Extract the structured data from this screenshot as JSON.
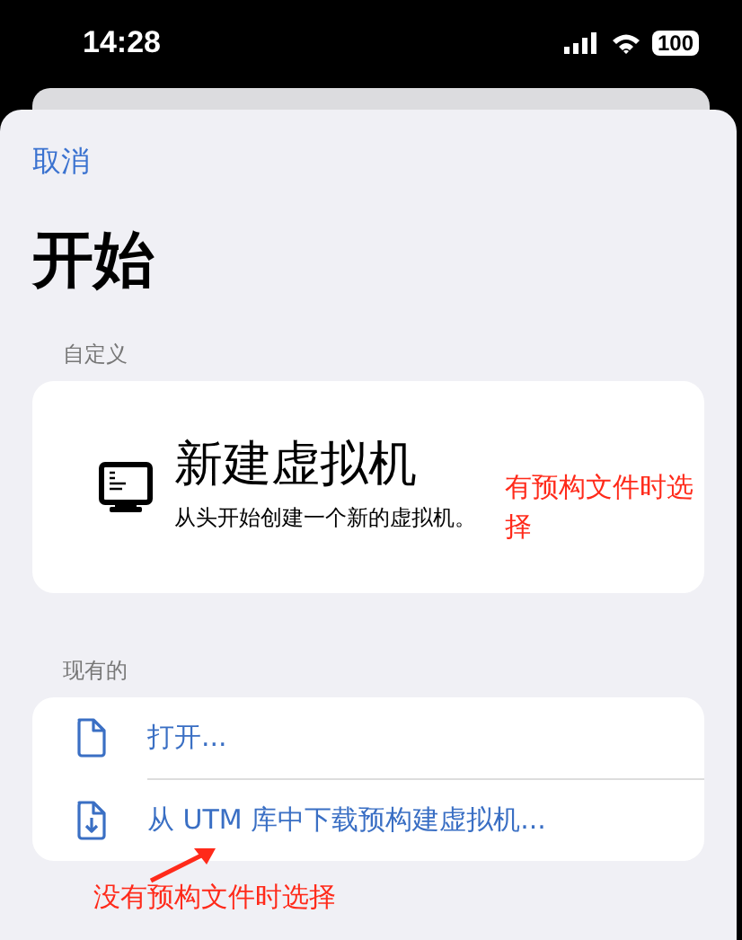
{
  "status_bar": {
    "time": "14:28",
    "battery": "100"
  },
  "sheet": {
    "cancel": "取消",
    "title": "开始",
    "sections": [
      {
        "header": "自定义",
        "kind": "large",
        "items": [
          {
            "title": "新建虚拟机",
            "subtitle": "从头开始创建一个新的虚拟机。"
          }
        ]
      },
      {
        "header": "现有的",
        "kind": "list",
        "items": [
          {
            "title": "打开..."
          },
          {
            "title": "从 UTM 库中下载预构建虚拟机..."
          }
        ]
      }
    ]
  },
  "annotations": [
    {
      "text": "有预构文件时选择",
      "arrow": false
    },
    {
      "text": "没有预构文件时选择",
      "arrow": true
    }
  ]
}
